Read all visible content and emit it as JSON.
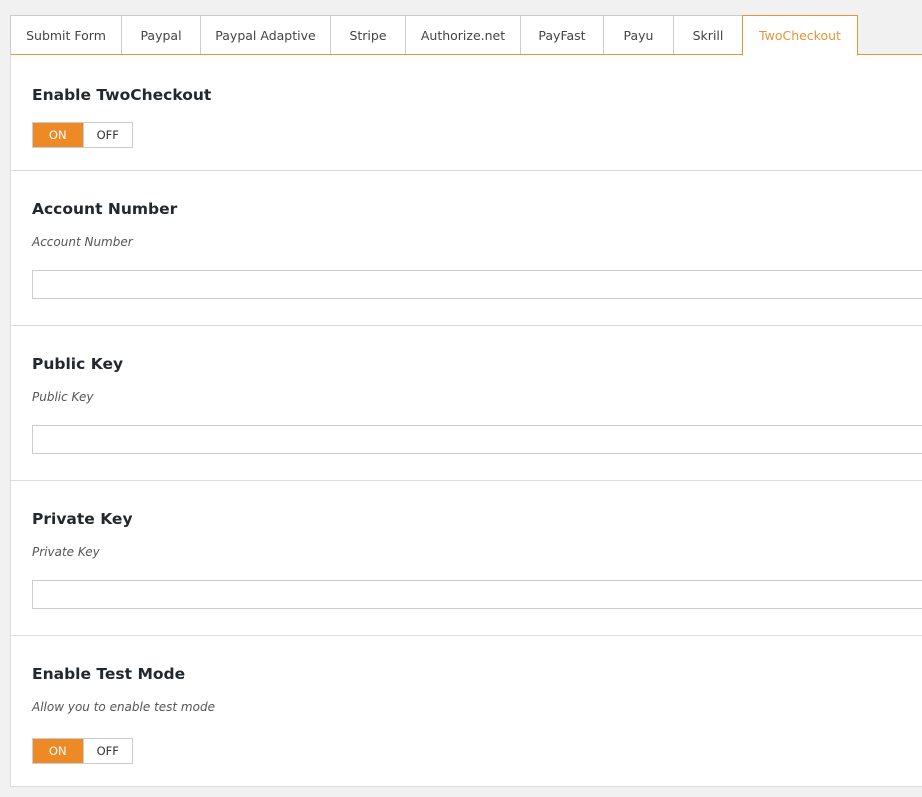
{
  "tabs": [
    {
      "label": "Submit Form",
      "active": false
    },
    {
      "label": "Paypal",
      "active": false
    },
    {
      "label": "Paypal Adaptive",
      "active": false
    },
    {
      "label": "Stripe",
      "active": false
    },
    {
      "label": "Authorize.net",
      "active": false
    },
    {
      "label": "PayFast",
      "active": false
    },
    {
      "label": "Payu",
      "active": false
    },
    {
      "label": "Skrill",
      "active": false
    },
    {
      "label": "TwoCheckout",
      "active": true
    }
  ],
  "sections": {
    "enable": {
      "title": "Enable TwoCheckout",
      "on_label": "ON",
      "off_label": "OFF",
      "selected": "ON"
    },
    "account_number": {
      "title": "Account Number",
      "description": "Account Number",
      "value": ""
    },
    "public_key": {
      "title": "Public Key",
      "description": "Public Key",
      "value": ""
    },
    "private_key": {
      "title": "Private Key",
      "description": "Private Key",
      "value": ""
    },
    "test_mode": {
      "title": "Enable Test Mode",
      "description": "Allow you to enable test mode",
      "on_label": "ON",
      "off_label": "OFF",
      "selected": "ON"
    }
  },
  "colors": {
    "accent": "#ee8a25",
    "tab_active_text": "#e8943a",
    "border": "#cccccc",
    "background": "#f1f1f1"
  }
}
